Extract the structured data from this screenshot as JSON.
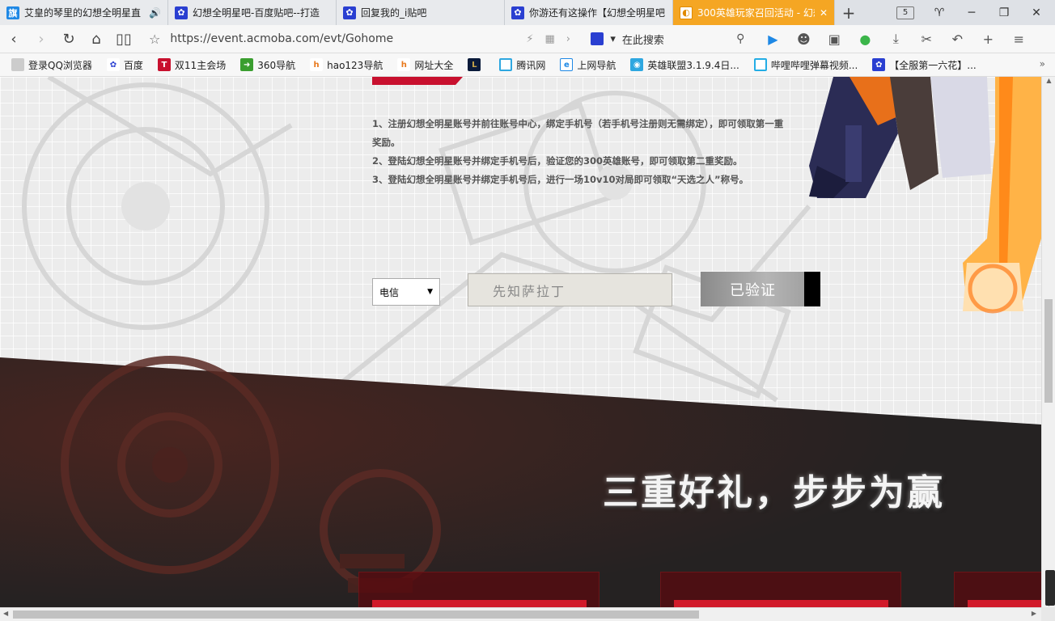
{
  "tabs": [
    {
      "title": "艾皇的琴里的幻想全明星直",
      "icon": "tieba-icon",
      "audio": "🔊"
    },
    {
      "title": "幻想全明星吧-百度贴吧--打造",
      "icon": "baidu-paw-icon"
    },
    {
      "title": "回复我的_i贴吧",
      "icon": "baidu-paw-icon"
    },
    {
      "title": "你游还有这操作【幻想全明星吧",
      "icon": "baidu-paw-icon"
    },
    {
      "title": "300英雄玩家召回活动 - 幻想",
      "icon": "300heroes-icon",
      "active": true
    }
  ],
  "tab_count": "5",
  "address_bar": {
    "url": "https://event.acmoba.com/evt/Gohome",
    "search_placeholder": "在此搜索"
  },
  "bookmarks": [
    {
      "label": "登录QQ浏览器",
      "icon": "qq-avatar-icon"
    },
    {
      "label": "百度",
      "icon": "baidu-paw-icon"
    },
    {
      "label": "双11主会场",
      "icon": "tmall-icon"
    },
    {
      "label": "360导航",
      "icon": "360-icon"
    },
    {
      "label": "hao123导航",
      "icon": "hao123-icon"
    },
    {
      "label": "网址大全",
      "icon": "hao-icon"
    },
    {
      "label": "",
      "icon": "lol-icon"
    },
    {
      "label": "腾讯网",
      "icon": "tencent-icon"
    },
    {
      "label": "上网导航",
      "icon": "ie-icon"
    },
    {
      "label": "英雄联盟3.1.9.4日...",
      "icon": "lol-client-icon"
    },
    {
      "label": "哔哩哔哩弹幕视频...",
      "icon": "bilibili-icon"
    },
    {
      "label": "【全服第一六花】...",
      "icon": "baidu-paw-icon"
    }
  ],
  "bookmarks_more": "»",
  "rules": [
    "1、注册幻想全明星账号并前往账号中心，绑定手机号（若手机号注册则无需绑定），即可领取第一重奖励。",
    "2、登陆幻想全明星账号并绑定手机号后，验证您的300英雄账号，即可领取第二重奖励。",
    "3、登陆幻想全明星账号并绑定手机号后，进行一场10v10对局即可领取“天选之人”称号。"
  ],
  "carrier_select": {
    "value": "电信"
  },
  "name_input": {
    "value": "先知萨拉丁"
  },
  "verify_button": {
    "label": "已验证"
  },
  "slogan": "三重好礼，步步为赢",
  "colors": {
    "active_tab": "#f5a623",
    "accent_red": "#d11a2a",
    "dark_bg": "#2a2626"
  }
}
